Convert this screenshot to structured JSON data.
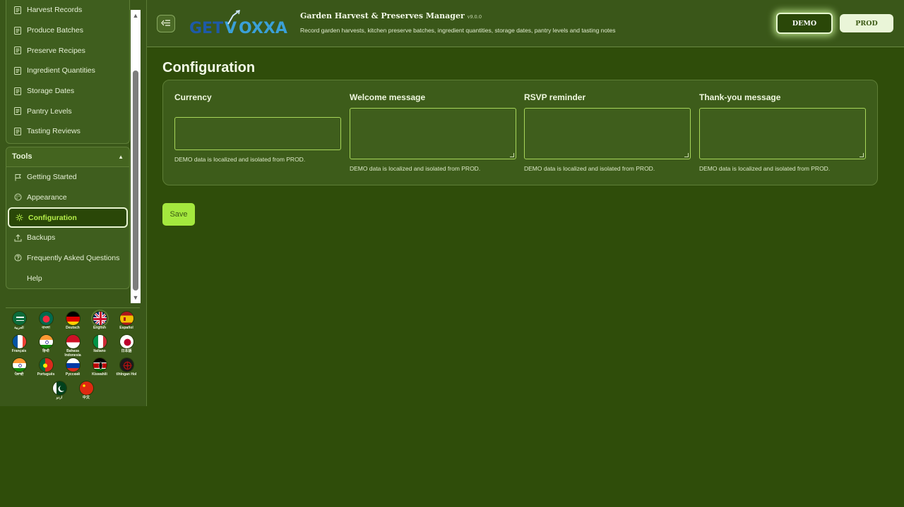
{
  "sidebar": {
    "items": [
      {
        "label": "Harvest Records",
        "icon": "document-icon"
      },
      {
        "label": "Produce Batches",
        "icon": "document-icon"
      },
      {
        "label": "Preserve Recipes",
        "icon": "document-icon"
      },
      {
        "label": "Ingredient Quantities",
        "icon": "document-icon"
      },
      {
        "label": "Storage Dates",
        "icon": "document-icon"
      },
      {
        "label": "Pantry Levels",
        "icon": "document-icon"
      },
      {
        "label": "Tasting Reviews",
        "icon": "document-icon"
      }
    ],
    "tools": {
      "title": "Tools",
      "items": [
        {
          "label": "Getting Started",
          "icon": "flag-icon"
        },
        {
          "label": "Appearance",
          "icon": "palette-icon"
        },
        {
          "label": "Configuration",
          "icon": "gear-icon",
          "active": true
        },
        {
          "label": "Backups",
          "icon": "upload-icon"
        },
        {
          "label": "Frequently Asked Questions",
          "icon": "question-icon"
        },
        {
          "label": "Help",
          "icon": ""
        }
      ]
    },
    "languages": [
      {
        "label": "العربية"
      },
      {
        "label": "বাংলা"
      },
      {
        "label": "Deutsch"
      },
      {
        "label": "English",
        "selected": true
      },
      {
        "label": "Español"
      },
      {
        "label": "Français"
      },
      {
        "label": "हिन्दी"
      },
      {
        "label": "Bahasa Indonesia"
      },
      {
        "label": "Italiano"
      },
      {
        "label": "日本語"
      },
      {
        "label": "ਪੰਜਾਬੀ"
      },
      {
        "label": "Português"
      },
      {
        "label": "Русский"
      },
      {
        "label": "Kiswahili"
      },
      {
        "label": "tlhIngan Hol"
      },
      {
        "label": "اردو"
      },
      {
        "label": "中文"
      }
    ]
  },
  "header": {
    "logo_text": "GETVOXXA",
    "title": "Garden Harvest & Preserves Manager",
    "version": "v9.0.0",
    "subtitle": "Record garden harvests, kitchen preserve batches, ingredient quantities, storage dates, pantry levels and tasting notes",
    "env_demo": "DEMO",
    "env_prod": "PROD",
    "menu_icon": "collapse-sidebar-icon"
  },
  "main": {
    "page_title": "Configuration",
    "fields": [
      {
        "label": "Currency",
        "type": "input",
        "value": "",
        "hint": "DEMO data is localized and isolated from PROD."
      },
      {
        "label": "Welcome message",
        "type": "textarea",
        "value": "",
        "hint": "DEMO data is localized and isolated from PROD."
      },
      {
        "label": "RSVP reminder",
        "type": "textarea",
        "value": "",
        "hint": "DEMO data is localized and isolated from PROD."
      },
      {
        "label": "Thank-you message",
        "type": "textarea",
        "value": "",
        "hint": "DEMO data is localized and isolated from PROD."
      }
    ],
    "save_label": "Save"
  },
  "colors": {
    "background": "#2f4d0a",
    "accent": "#a4e83e",
    "active_text": "#b6f04a"
  }
}
